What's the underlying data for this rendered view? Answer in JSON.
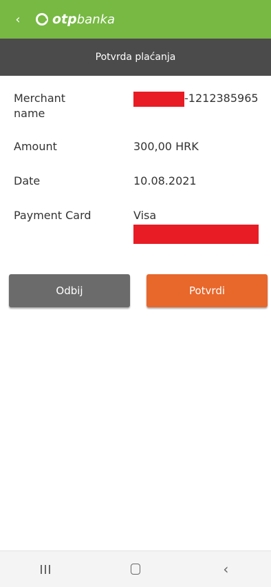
{
  "header": {
    "back_icon": "chevron-left-icon",
    "logo_text_bold": "otp",
    "logo_text_regular": "banka"
  },
  "title_bar": {
    "title": "Potvrda plaćanja"
  },
  "details": {
    "merchant_label": "Merchant\nname",
    "merchant_value_suffix": "-1212385965",
    "amount_label": "Amount",
    "amount_value": "300,00 HRK",
    "date_label": "Date",
    "date_value": "10.08.2021",
    "card_label": "Payment Card",
    "card_value": "Visa"
  },
  "buttons": {
    "decline": "Odbij",
    "confirm": "Potvrdi"
  },
  "colors": {
    "header_bg": "#77b943",
    "title_bg": "#4b4b4b",
    "decline_bg": "#6b6b6b",
    "confirm_bg": "#e8672b",
    "redaction": "#e81c24"
  },
  "system_nav": {
    "recents_icon": "recents-icon",
    "home_icon": "home-icon",
    "back_icon": "back-icon"
  }
}
